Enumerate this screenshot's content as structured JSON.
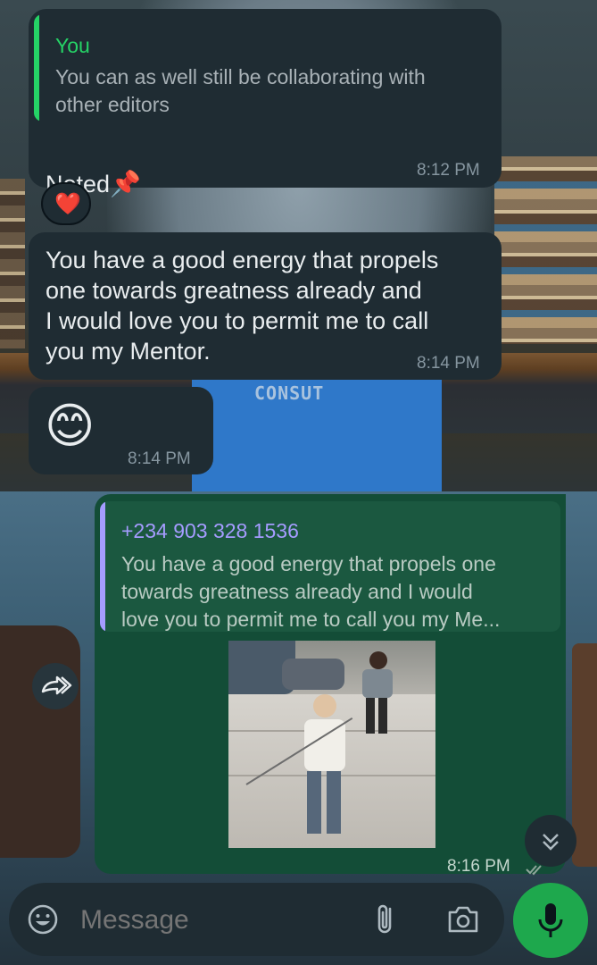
{
  "chat": {
    "msg1": {
      "reply_name": "You",
      "reply_text": "You can as well still be collaborating with\nother editors",
      "text": "Noted",
      "emoji": "📌",
      "time": "8:12 PM",
      "reaction": "❤️"
    },
    "msg2": {
      "text": "You have a good energy that propels\none towards greatness already and\nI would love you to permit me to call\nyou my Mentor.",
      "time": "8:14 PM"
    },
    "msg3": {
      "emoji": "😊",
      "time": "8:14 PM"
    },
    "msg4": {
      "reply_name": "+234 903 328 1536",
      "reply_text": "You have a good energy that propels one\ntowards greatness already and I would\nlove you to permit me to call you my Me...",
      "time": "8:16 PM",
      "status_icon": "double-check-icon"
    }
  },
  "background_text": "CONSUT",
  "composer": {
    "placeholder": "Message"
  },
  "colors": {
    "incoming_bubble": "#1f2c33",
    "outgoing_bubble": "#134d37",
    "you_name": "#25d366",
    "contact_name": "#a59cff",
    "mic_button": "#1ea84d"
  },
  "icons": [
    "emoji-icon",
    "attach-icon",
    "camera-icon",
    "mic-icon",
    "forward-icon",
    "scroll-down-icon",
    "pushpin-icon",
    "heart-icon"
  ]
}
